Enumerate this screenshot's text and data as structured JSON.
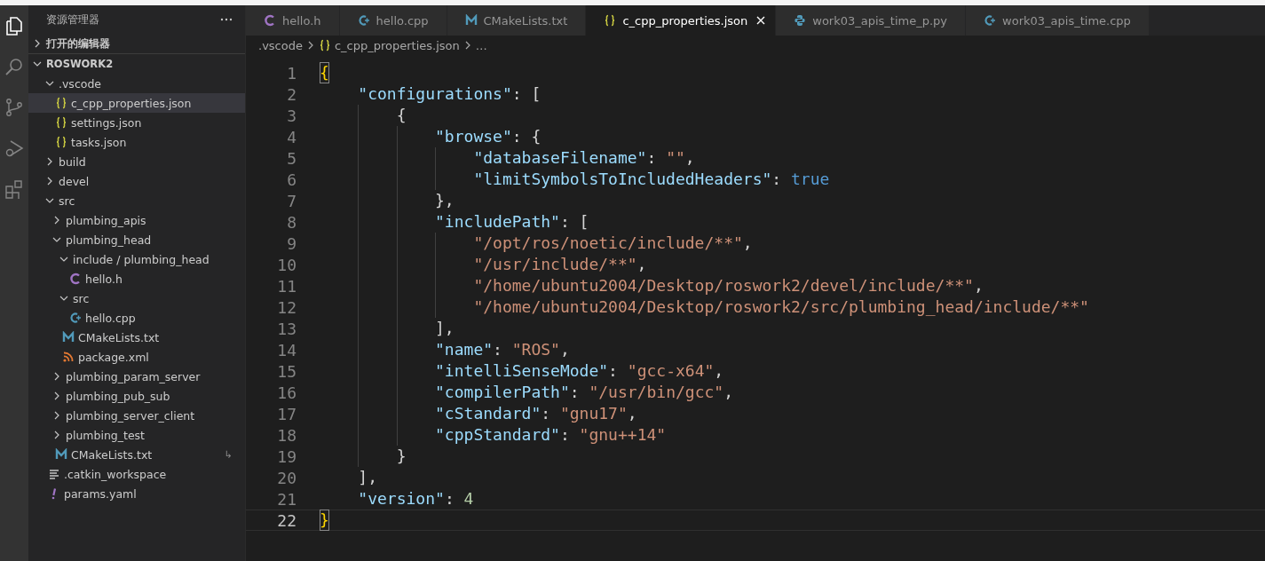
{
  "sidebar": {
    "title": "资源管理器",
    "sections": [
      {
        "title": "打开的编辑器",
        "expanded": false
      },
      {
        "title": "ROSWORK2",
        "expanded": true,
        "items": [
          {
            "label": ".vscode",
            "kind": "folder",
            "expanded": true,
            "selected": false,
            "children": [
              {
                "label": "c_cpp_properties.json",
                "kind": "json",
                "selected": true
              },
              {
                "label": "settings.json",
                "kind": "json",
                "selected": false
              },
              {
                "label": "tasks.json",
                "kind": "json",
                "selected": false
              }
            ]
          },
          {
            "label": "build",
            "kind": "folder",
            "expanded": false,
            "selected": false
          },
          {
            "label": "devel",
            "kind": "folder",
            "expanded": false,
            "selected": false
          },
          {
            "label": "src",
            "kind": "folder",
            "expanded": true,
            "selected": false,
            "children": [
              {
                "label": "plumbing_apis",
                "kind": "folder",
                "expanded": false,
                "selected": false
              },
              {
                "label": "plumbing_head",
                "kind": "folder",
                "expanded": true,
                "selected": false,
                "children": [
                  {
                    "label": "include / plumbing_head",
                    "kind": "folder",
                    "expanded": true,
                    "selected": false,
                    "children": [
                      {
                        "label": "hello.h",
                        "kind": "c",
                        "selected": false
                      }
                    ]
                  },
                  {
                    "label": "src",
                    "kind": "folder",
                    "expanded": true,
                    "selected": false,
                    "children": [
                      {
                        "label": "hello.cpp",
                        "kind": "cpp",
                        "selected": false
                      }
                    ]
                  },
                  {
                    "label": "CMakeLists.txt",
                    "kind": "cmake",
                    "selected": false
                  },
                  {
                    "label": "package.xml",
                    "kind": "xml",
                    "selected": false
                  }
                ]
              },
              {
                "label": "plumbing_param_server",
                "kind": "folder",
                "expanded": false,
                "selected": false
              },
              {
                "label": "plumbing_pub_sub",
                "kind": "folder",
                "expanded": false,
                "selected": false
              },
              {
                "label": "plumbing_server_client",
                "kind": "folder",
                "expanded": false,
                "selected": false
              },
              {
                "label": "plumbing_test",
                "kind": "folder",
                "expanded": false,
                "selected": false
              },
              {
                "label": "CMakeLists.txt",
                "kind": "cmake",
                "selected": false,
                "badge": "↳"
              }
            ]
          },
          {
            "label": ".catkin_workspace",
            "kind": "text",
            "selected": false
          },
          {
            "label": "params.yaml",
            "kind": "yaml",
            "selected": false
          }
        ]
      }
    ]
  },
  "tabs": [
    {
      "label": "hello.h",
      "kind": "c",
      "selected": false
    },
    {
      "label": "hello.cpp",
      "kind": "cpp",
      "selected": false
    },
    {
      "label": "CMakeLists.txt",
      "kind": "cmake",
      "selected": false
    },
    {
      "label": "c_cpp_properties.json",
      "kind": "json",
      "selected": true
    },
    {
      "label": "work03_apis_time_p.py",
      "kind": "python",
      "selected": false
    },
    {
      "label": "work03_apis_time.cpp",
      "kind": "cpp",
      "selected": false
    }
  ],
  "breadcrumb": [
    {
      "label": ".vscode",
      "kind": "folder"
    },
    {
      "label": "c_cpp_properties.json",
      "kind": "json"
    },
    {
      "label": "…",
      "kind": "more"
    }
  ],
  "code": [
    {
      "number": "1",
      "current": false,
      "tokens": [
        {
          "kind": "bracket",
          "text": "{"
        }
      ]
    },
    {
      "number": "2",
      "current": false,
      "tokens": [
        {
          "kind": "key",
          "text": "    \"configurations\""
        },
        {
          "kind": "punct",
          "text": ": ["
        }
      ]
    },
    {
      "number": "3",
      "current": false,
      "tokens": [
        {
          "kind": "punct",
          "text": "        {"
        }
      ]
    },
    {
      "number": "4",
      "current": false,
      "tokens": [
        {
          "kind": "key",
          "text": "            \"browse\""
        },
        {
          "kind": "punct",
          "text": ": {"
        }
      ]
    },
    {
      "number": "5",
      "current": false,
      "tokens": [
        {
          "kind": "key",
          "text": "                \"databaseFilename\""
        },
        {
          "kind": "punct",
          "text": ": "
        },
        {
          "kind": "string",
          "text": "\"\""
        },
        {
          "kind": "punct",
          "text": ","
        }
      ]
    },
    {
      "number": "6",
      "current": false,
      "tokens": [
        {
          "kind": "key",
          "text": "                \"limitSymbolsToIncludedHeaders\""
        },
        {
          "kind": "punct",
          "text": ": "
        },
        {
          "kind": "bool",
          "text": "true"
        }
      ]
    },
    {
      "number": "7",
      "current": false,
      "tokens": [
        {
          "kind": "punct",
          "text": "            },"
        }
      ]
    },
    {
      "number": "8",
      "current": false,
      "tokens": [
        {
          "kind": "key",
          "text": "            \"includePath\""
        },
        {
          "kind": "punct",
          "text": ": ["
        }
      ]
    },
    {
      "number": "9",
      "current": false,
      "tokens": [
        {
          "kind": "string",
          "text": "                \"/opt/ros/noetic/include/**\""
        },
        {
          "kind": "punct",
          "text": ","
        }
      ]
    },
    {
      "number": "10",
      "current": false,
      "tokens": [
        {
          "kind": "string",
          "text": "                \"/usr/include/**\""
        },
        {
          "kind": "punct",
          "text": ","
        }
      ]
    },
    {
      "number": "11",
      "current": false,
      "tokens": [
        {
          "kind": "string",
          "text": "                \"/home/ubuntu2004/Desktop/roswork2/devel/include/**\""
        },
        {
          "kind": "punct",
          "text": ","
        }
      ]
    },
    {
      "number": "12",
      "current": false,
      "tokens": [
        {
          "kind": "string",
          "text": "                \"/home/ubuntu2004/Desktop/roswork2/src/plumbing_head/include/**\""
        }
      ]
    },
    {
      "number": "13",
      "current": false,
      "tokens": [
        {
          "kind": "punct",
          "text": "            ],"
        }
      ]
    },
    {
      "number": "14",
      "current": false,
      "tokens": [
        {
          "kind": "key",
          "text": "            \"name\""
        },
        {
          "kind": "punct",
          "text": ": "
        },
        {
          "kind": "string",
          "text": "\"ROS\""
        },
        {
          "kind": "punct",
          "text": ","
        }
      ]
    },
    {
      "number": "15",
      "current": false,
      "tokens": [
        {
          "kind": "key",
          "text": "            \"intelliSenseMode\""
        },
        {
          "kind": "punct",
          "text": ": "
        },
        {
          "kind": "string",
          "text": "\"gcc-x64\""
        },
        {
          "kind": "punct",
          "text": ","
        }
      ]
    },
    {
      "number": "16",
      "current": false,
      "tokens": [
        {
          "kind": "key",
          "text": "            \"compilerPath\""
        },
        {
          "kind": "punct",
          "text": ": "
        },
        {
          "kind": "string",
          "text": "\"/usr/bin/gcc\""
        },
        {
          "kind": "punct",
          "text": ","
        }
      ]
    },
    {
      "number": "17",
      "current": false,
      "tokens": [
        {
          "kind": "key",
          "text": "            \"cStandard\""
        },
        {
          "kind": "punct",
          "text": ": "
        },
        {
          "kind": "string",
          "text": "\"gnu17\""
        },
        {
          "kind": "punct",
          "text": ","
        }
      ]
    },
    {
      "number": "18",
      "current": false,
      "tokens": [
        {
          "kind": "key",
          "text": "            \"cppStandard\""
        },
        {
          "kind": "punct",
          "text": ": "
        },
        {
          "kind": "string",
          "text": "\"gnu++14\""
        }
      ]
    },
    {
      "number": "19",
      "current": false,
      "tokens": [
        {
          "kind": "punct",
          "text": "        }"
        }
      ]
    },
    {
      "number": "20",
      "current": false,
      "tokens": [
        {
          "kind": "punct",
          "text": "    ],"
        }
      ]
    },
    {
      "number": "21",
      "current": false,
      "tokens": [
        {
          "kind": "key",
          "text": "    \"version\""
        },
        {
          "kind": "punct",
          "text": ": "
        },
        {
          "kind": "number",
          "text": "4"
        }
      ]
    },
    {
      "number": "22",
      "current": true,
      "tokens": [
        {
          "kind": "bracket",
          "text": "}"
        }
      ]
    }
  ]
}
